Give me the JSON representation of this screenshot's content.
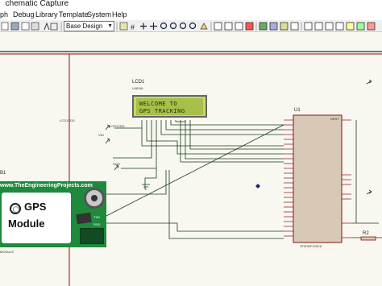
{
  "window": {
    "title": "chematic Capture"
  },
  "menu": [
    "ph",
    "Debug",
    "Library",
    "Template",
    "System",
    "Help"
  ],
  "toolbar": {
    "layer_select": "Base Design"
  },
  "schematic": {
    "lcd": {
      "ref": "LCD1",
      "part": "LM016L",
      "line1": "WELCOME TO",
      "line2": "GPS TRACKING"
    },
    "mcu": {
      "ref": "U1",
      "part": "STM32F103C8",
      "header": "NRST"
    },
    "resistor": {
      "ref": "R2"
    },
    "gps_ref": "B1",
    "gps_module_label": "MODULE",
    "gps": {
      "url": "www.TheEngineeringProjects.com",
      "line1": "GPS",
      "line2": "Module",
      "pin_txd": "TXD",
      "pin_rxd": "RXD"
    },
    "terminals": [
      "LCD1VDD",
      "LCD1VDD",
      "GND",
      "VIN"
    ]
  },
  "colors": {
    "canvas": "#f8f8f0",
    "wire": "#1a3a1a",
    "component": "#8a1010",
    "gps_board": "#1f8a3c",
    "lcd_bg": "#c8d86a"
  }
}
